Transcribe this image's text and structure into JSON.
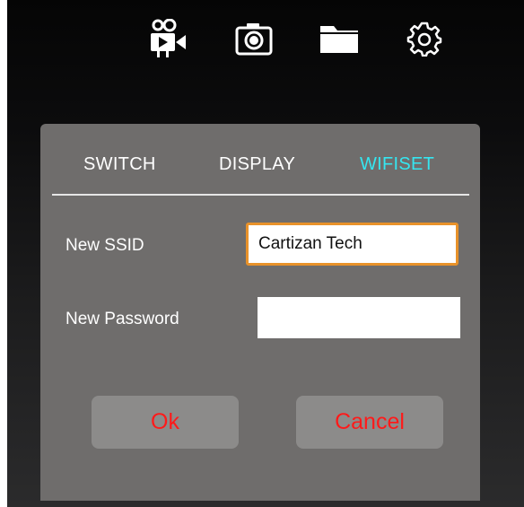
{
  "toolbar": {
    "icons": [
      "video-camera-icon",
      "camera-icon",
      "folder-icon",
      "gear-icon"
    ]
  },
  "dialog": {
    "tabs": [
      {
        "label": "SWITCH",
        "active": false
      },
      {
        "label": "DISPLAY",
        "active": false
      },
      {
        "label": "WIFISET",
        "active": true
      }
    ],
    "ssid": {
      "label": "New SSID",
      "value": "Cartizan Tech"
    },
    "password": {
      "label": "New Password",
      "value": ""
    },
    "ok_label": "Ok",
    "cancel_label": "Cancel"
  },
  "colors": {
    "active_tab": "#35e6f0",
    "button_text": "#ff1a1a",
    "focus_border": "#e8922a",
    "dialog_bg": "#6f6d6c"
  }
}
